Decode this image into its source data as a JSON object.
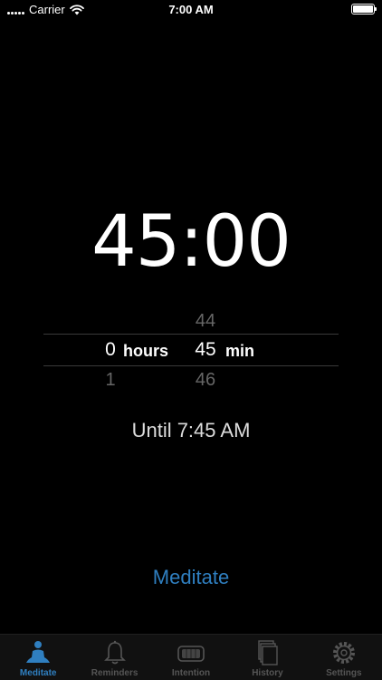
{
  "status_bar": {
    "carrier": "Carrier",
    "time": "7:00 AM"
  },
  "timer": {
    "display": "45:00"
  },
  "picker": {
    "hours": {
      "above": "",
      "selected": "0",
      "below": "1",
      "label": "hours"
    },
    "minutes": {
      "above": "44",
      "selected": "45",
      "below": "46",
      "label": "min"
    }
  },
  "until": {
    "text": "Until 7:45 AM"
  },
  "actions": {
    "meditate_label": "Meditate"
  },
  "tabs": [
    {
      "label": "Meditate",
      "icon": "meditator-icon",
      "active": true
    },
    {
      "label": "Reminders",
      "icon": "bell-icon",
      "active": false
    },
    {
      "label": "Intention",
      "icon": "intention-icon",
      "active": false
    },
    {
      "label": "History",
      "icon": "history-icon",
      "active": false
    },
    {
      "label": "Settings",
      "icon": "gear-icon",
      "active": false
    }
  ],
  "colors": {
    "accent": "#2f7fc0",
    "background": "#000000",
    "inactive_tab": "#555555"
  }
}
